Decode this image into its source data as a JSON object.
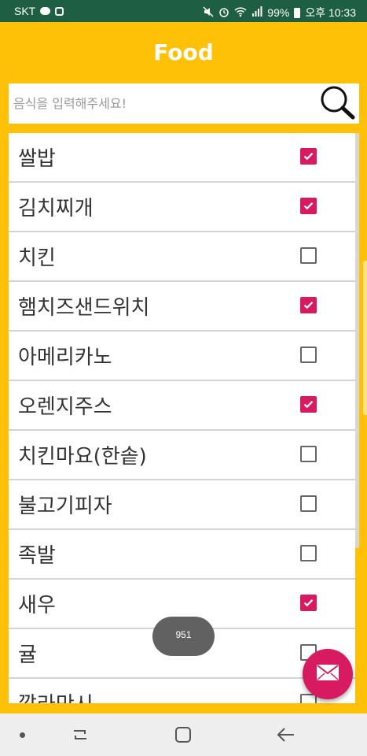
{
  "status_bar": {
    "carrier": "SKT",
    "battery": "99%",
    "time": "오후 10:33"
  },
  "app": {
    "title": "Food"
  },
  "search": {
    "placeholder": "음식을 입력해주세요!",
    "icon": "search-icon"
  },
  "foods": [
    {
      "name": "쌀밥",
      "checked": true
    },
    {
      "name": "김치찌개",
      "checked": true
    },
    {
      "name": "치킨",
      "checked": false
    },
    {
      "name": "햄치즈샌드위치",
      "checked": true
    },
    {
      "name": "아메리카노",
      "checked": false
    },
    {
      "name": "오렌지주스",
      "checked": true
    },
    {
      "name": "치킨마요(한솥)",
      "checked": false
    },
    {
      "name": "불고기피자",
      "checked": false
    },
    {
      "name": "족발",
      "checked": false
    },
    {
      "name": "새우",
      "checked": true
    },
    {
      "name": "귤",
      "checked": false
    },
    {
      "name": "깔라만시",
      "checked": false
    }
  ],
  "toast": {
    "text": "951"
  },
  "fab": {
    "icon": "mail-icon"
  },
  "colors": {
    "primary": "#FFC107",
    "accent": "#D81B60",
    "status_bar": "#1e5f43"
  }
}
